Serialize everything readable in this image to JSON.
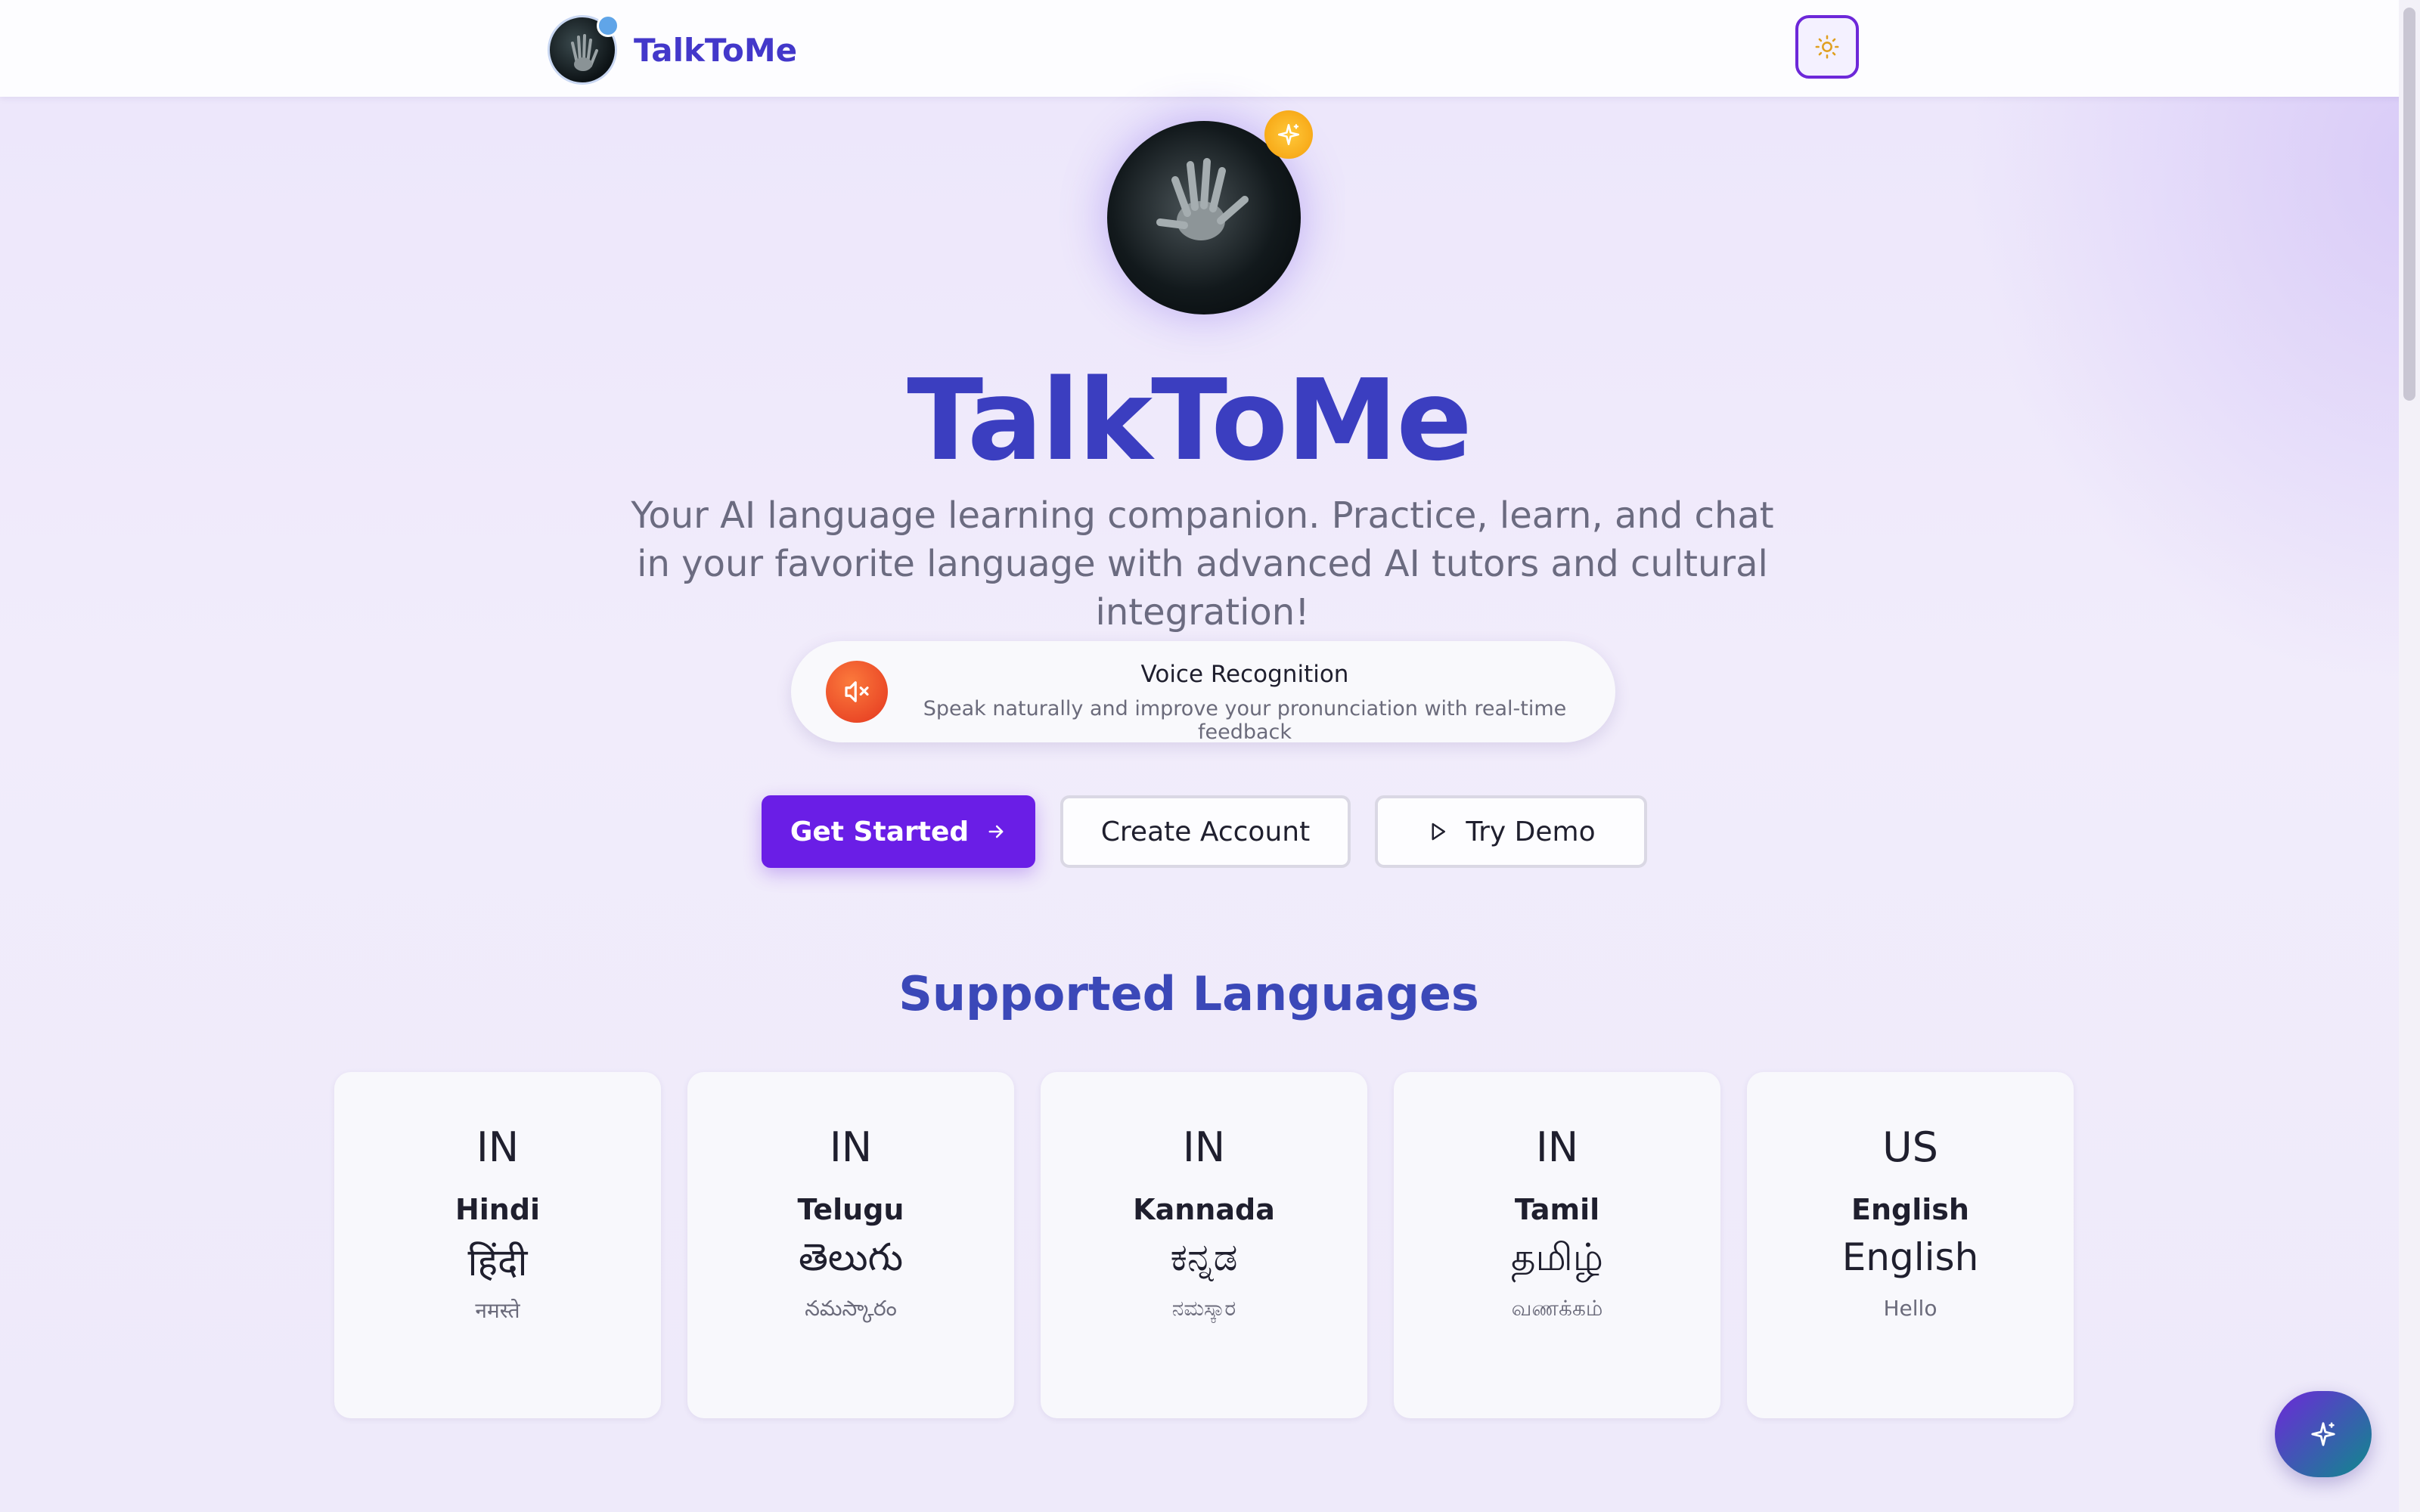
{
  "header": {
    "brand_name": "TalkToMe",
    "theme_icon": "sun-icon"
  },
  "hero": {
    "title": "TalkToMe",
    "subtitle": "Your AI language learning companion. Practice, learn, and chat in your favorite language with advanced AI tutors and cultural integration!",
    "badge_icon": "sparkles-icon"
  },
  "feature": {
    "icon": "speaker-muted-icon",
    "title": "Voice Recognition",
    "description": "Speak naturally and improve your pronunciation with real-time feedback"
  },
  "actions": {
    "get_started": "Get Started",
    "create_account": "Create Account",
    "try_demo": "Try Demo"
  },
  "languages": {
    "title": "Supported Languages",
    "items": [
      {
        "code": "IN",
        "name": "Hindi",
        "native": "हिंदी",
        "greeting": "नमस्ते"
      },
      {
        "code": "IN",
        "name": "Telugu",
        "native": "తెలుగు",
        "greeting": "నమస్కారం"
      },
      {
        "code": "IN",
        "name": "Kannada",
        "native": "ಕನ್ನಡ",
        "greeting": "ನಮಸ್ಕಾರ"
      },
      {
        "code": "IN",
        "name": "Tamil",
        "native": "தமிழ்",
        "greeting": "வணக்கம்"
      },
      {
        "code": "US",
        "name": "English",
        "native": "English",
        "greeting": "Hello"
      }
    ]
  },
  "colors": {
    "accent": "#6a1ee6",
    "title": "#3b3ec0",
    "mic_badge": "#e4361f"
  },
  "fab_icon": "sparkles-icon"
}
